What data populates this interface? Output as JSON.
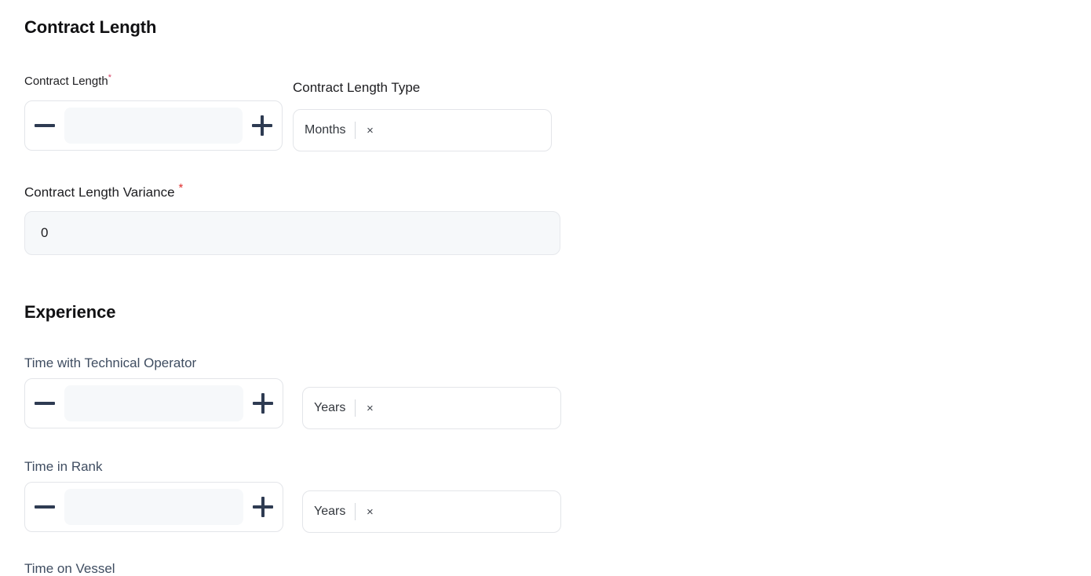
{
  "sections": [
    {
      "id": "contract-length",
      "heading": "Contract Length",
      "fields": {
        "contract_length": {
          "label": "Contract Length",
          "required_marker": "*",
          "value": "",
          "placeholder": "",
          "decrement_label": "−",
          "increment_label": "+"
        },
        "contract_length_type": {
          "label": "Contract Length Type",
          "selected_tag": "Months",
          "remove_label": "×"
        },
        "contract_length_variance": {
          "label": "Contract Length Variance",
          "required_marker": "*",
          "value": "0",
          "placeholder": ""
        }
      }
    },
    {
      "id": "experience",
      "heading": "Experience",
      "fields": {
        "time_with_technical_operator": {
          "label": "Time with Technical Operator",
          "value": "",
          "placeholder": "",
          "decrement_label": "−",
          "increment_label": "+",
          "unit_tag": "Years",
          "remove_label": "×"
        },
        "time_in_rank": {
          "label": "Time in Rank",
          "value": "",
          "placeholder": "",
          "decrement_label": "−",
          "increment_label": "+",
          "unit_tag": "Years",
          "remove_label": "×"
        },
        "time_on_vessel": {
          "label": "Time on Vessel"
        }
      }
    }
  ],
  "colors": {
    "required_asterisk": "#d53f62",
    "required_asterisk_alt": "#e03131",
    "stepper_glyph": "#2e3b52",
    "label_slate": "#3f4d61",
    "field_fill": "#f6f8fa",
    "field_border": "#e3e5e9",
    "heading": "#111113"
  }
}
